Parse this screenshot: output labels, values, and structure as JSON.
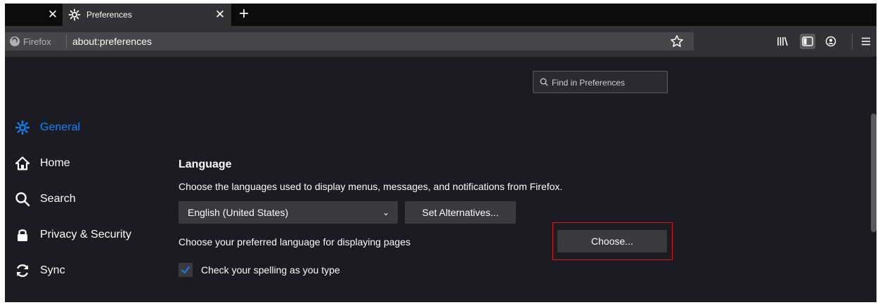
{
  "tabs": {
    "active_title": "Preferences"
  },
  "navbar": {
    "identity_label": "Firefox",
    "url": "about:preferences"
  },
  "search": {
    "placeholder": "Find in Preferences"
  },
  "sidebar": {
    "items": [
      {
        "label": "General",
        "icon": "gear-icon",
        "selected": true
      },
      {
        "label": "Home",
        "icon": "home-icon",
        "selected": false
      },
      {
        "label": "Search",
        "icon": "search-icon",
        "selected": false
      },
      {
        "label": "Privacy & Security",
        "icon": "lock-icon",
        "selected": false
      },
      {
        "label": "Sync",
        "icon": "sync-icon",
        "selected": false
      }
    ]
  },
  "language": {
    "heading": "Language",
    "description": "Choose the languages used to display menus, messages, and notifications from Firefox.",
    "selected_language": "English (United States)",
    "set_alternatives_label": "Set Alternatives...",
    "preferred_label": "Choose your preferred language for displaying pages",
    "choose_label": "Choose...",
    "spellcheck_label": "Check your spelling as you type",
    "spellcheck_checked": true
  },
  "colors": {
    "accent": "#0a84ff",
    "highlight_border": "#d01d1d",
    "background": "#1c1b22"
  }
}
